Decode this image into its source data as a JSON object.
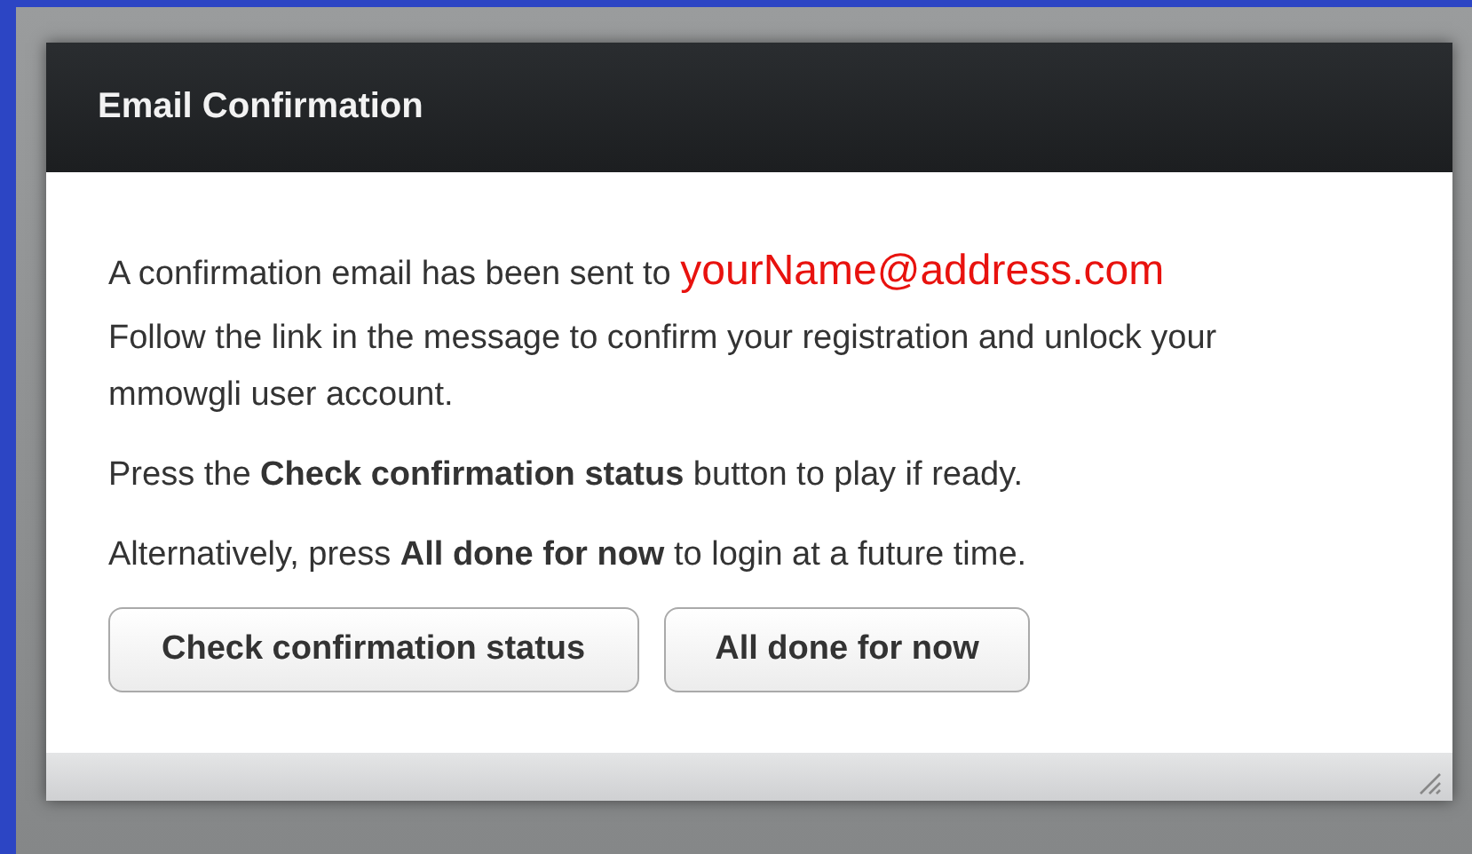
{
  "dialog": {
    "title": "Email Confirmation",
    "sent_notice": {
      "text": "A confirmation email has been sent to",
      "email": "yourName@address.com"
    },
    "paragraphs": [
      "Follow the link in the message to confirm your registration and unlock your mmowgli user account.",
      "Press the **Check confirmation status** button to play if ready.",
      "Alternatively, press **All done for now** to login at a future time."
    ],
    "buttons": [
      "Check confirmation status",
      "All done for now"
    ]
  }
}
